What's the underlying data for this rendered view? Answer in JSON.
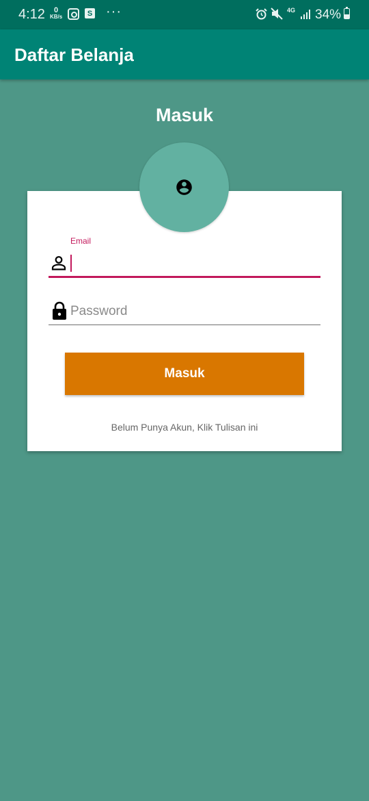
{
  "status_bar": {
    "time": "4:12",
    "data_rate_value": "0",
    "data_rate_unit": "KB/s",
    "more": "···",
    "network": "4G",
    "battery": "34%"
  },
  "app_bar": {
    "title": "Daftar Belanja"
  },
  "page": {
    "heading": "Masuk"
  },
  "form": {
    "email_label": "Email",
    "email_value": "",
    "password_placeholder": "Password",
    "submit_label": "Masuk",
    "register_link": "Belum Punya Akun, Klik Tulisan ini"
  },
  "colors": {
    "background": "#4e9787",
    "app_bar": "#008375",
    "status_bar": "#006e5e",
    "avatar": "#62b1a1",
    "accent": "#c2185b",
    "button": "#d97700"
  }
}
